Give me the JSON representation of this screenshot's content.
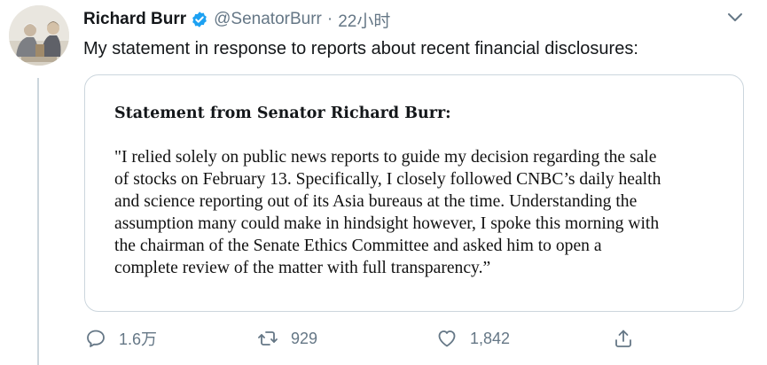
{
  "tweet": {
    "author": {
      "display_name": "Richard Burr",
      "handle": "@SenatorBurr",
      "verified": true,
      "avatar_icon": "profile-photo"
    },
    "separator": "·",
    "timestamp": "22小时",
    "text": "My statement in response to reports about recent financial disclosures:",
    "menu_icon": "chevron-down-icon"
  },
  "card": {
    "title": "Statement from Senator Richard Burr:",
    "lines": [
      "\"I relied solely on public news reports to guide my decision regarding the sale",
      "of stocks on February 13. Specifically, I closely followed CNBC’s daily health",
      "and science reporting out of its Asia bureaus at the time. Understanding the",
      "assumption many could make in hindsight however, I spoke this morning with",
      "the chairman of the Senate Ethics Committee and asked him to open a",
      "complete review of the matter with full transparency.”"
    ]
  },
  "actions": {
    "reply": {
      "icon": "reply-icon",
      "count": "1.6万"
    },
    "retweet": {
      "icon": "retweet-icon",
      "count": "929"
    },
    "like": {
      "icon": "like-icon",
      "count": "1,842"
    },
    "share": {
      "icon": "share-icon"
    }
  },
  "colors": {
    "text_primary": "#14171a",
    "text_secondary": "#657786",
    "border": "#ccd6dd",
    "verified_blue": "#1da1f2"
  }
}
